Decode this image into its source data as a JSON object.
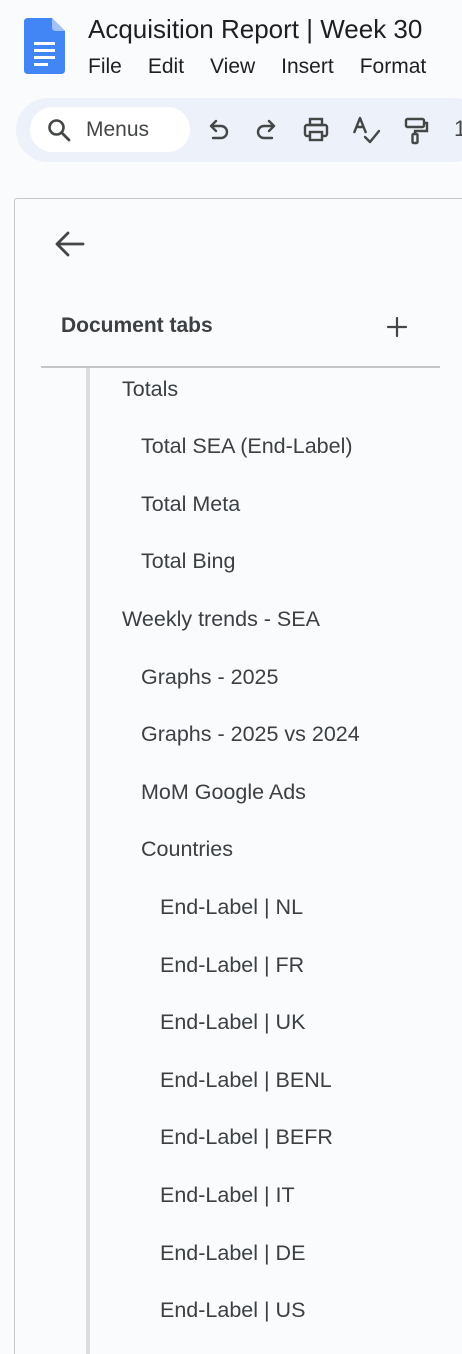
{
  "document": {
    "title": "Acquisition Report | Week 30"
  },
  "menubar": {
    "items": [
      "File",
      "Edit",
      "View",
      "Insert",
      "Format"
    ]
  },
  "toolbar": {
    "search_label": "Menus",
    "icons": [
      "search-icon",
      "undo-icon",
      "redo-icon",
      "print-icon",
      "spellcheck-icon",
      "paint-format-icon"
    ],
    "zoom_partial": "1"
  },
  "sidebar": {
    "heading": "Document tabs",
    "tabs": [
      {
        "label": "Totals",
        "level": 1
      },
      {
        "label": "Total SEA (End-Label)",
        "level": 2
      },
      {
        "label": "Total Meta",
        "level": 2
      },
      {
        "label": "Total Bing",
        "level": 2
      },
      {
        "label": "Weekly trends - SEA",
        "level": 1
      },
      {
        "label": "Graphs - 2025",
        "level": 2
      },
      {
        "label": "Graphs - 2025 vs 2024",
        "level": 2
      },
      {
        "label": "MoM Google Ads",
        "level": 2
      },
      {
        "label": "Countries",
        "level": 2
      },
      {
        "label": "End-Label | NL",
        "level": 3
      },
      {
        "label": "End-Label | FR",
        "level": 3
      },
      {
        "label": "End-Label | UK",
        "level": 3
      },
      {
        "label": "End-Label | BENL",
        "level": 3
      },
      {
        "label": "End-Label | BEFR",
        "level": 3
      },
      {
        "label": "End-Label | IT",
        "level": 3
      },
      {
        "label": "End-Label | DE",
        "level": 3
      },
      {
        "label": "End-Label | US",
        "level": 3
      }
    ]
  },
  "colors": {
    "docs_blue": "#4285f4",
    "background": "#f9fbfd",
    "toolbar_bg": "#edf2fa",
    "text": "#3c4043"
  }
}
